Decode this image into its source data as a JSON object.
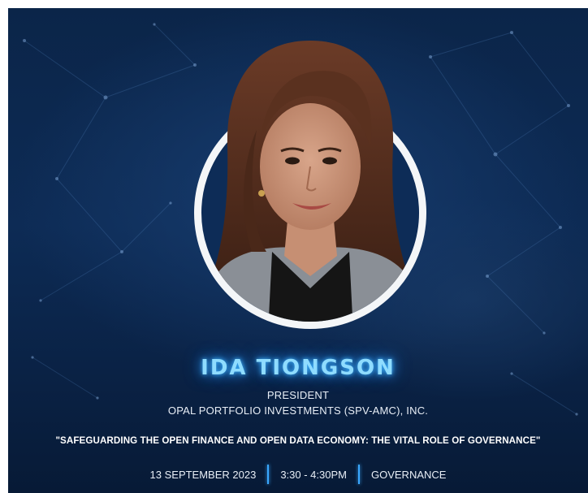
{
  "speaker": {
    "name": "IDA TIONGSON",
    "title": "PRESIDENT",
    "organization": "OPAL PORTFOLIO INVESTMENTS (SPV-AMC), INC."
  },
  "session": {
    "topic": "\"SAFEGUARDING THE OPEN FINANCE AND OPEN DATA ECONOMY: THE VITAL ROLE OF GOVERNANCE\"",
    "date": "13 SEPTEMBER 2023",
    "time": "3:30 - 4:30PM",
    "track": "GOVERNANCE"
  },
  "colors": {
    "background": "#0b2549",
    "name_glow": "#8fdcff",
    "separator": "#3aa8ff",
    "ring": "#f4f6f8"
  },
  "icons": {
    "background": "network-lines-graphic",
    "portrait": "speaker-photo"
  }
}
